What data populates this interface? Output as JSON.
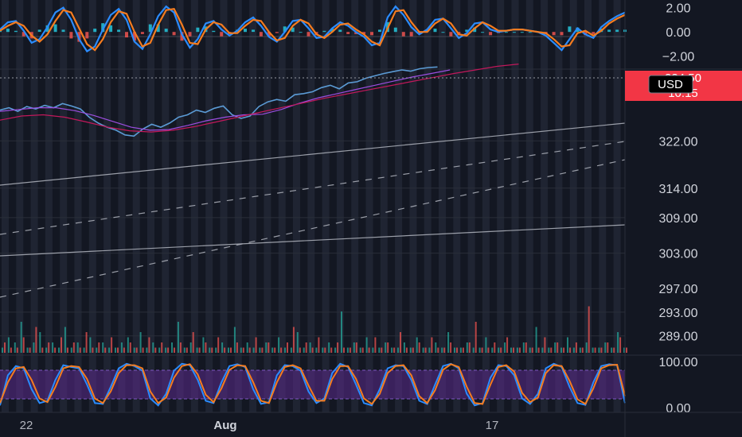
{
  "chart_data": [
    {
      "type": "line",
      "panel": "macd",
      "y_axis_ticks": [
        "2.00",
        "0.00",
        "−2.00"
      ],
      "ylim": [
        -3,
        2.5
      ],
      "series": [
        {
          "values": [
            0.2,
            0.8,
            0.9,
            0.1,
            -0.9,
            -0.6,
            0.4,
            1.6,
            2.0,
            1.0,
            -0.6,
            -1.6,
            -1.2,
            0.2,
            1.4,
            1.9,
            1.0,
            -0.8,
            -1.4,
            -0.2,
            1.3,
            2.1,
            1.6,
            -0.2,
            -1.3,
            -0.6,
            0.7,
            0.9,
            0.2,
            -0.3,
            0.1,
            0.8,
            1.2,
            0.5,
            -0.4,
            -0.8,
            0.0,
            0.9,
            1.0,
            0.3,
            -0.5,
            -0.4,
            0.3,
            0.8,
            0.5,
            0.0,
            -0.4,
            -1.1,
            -0.9,
            1.2,
            2.1,
            1.4,
            0.4,
            -0.2,
            0.2,
            1.0,
            1.1,
            0.3,
            -0.5,
            -0.1,
            0.7,
            0.8,
            0.2,
            0.0,
            0.1,
            0.2,
            0.2,
            0.1,
            0.0,
            -0.3,
            -0.9,
            -1.5,
            -0.6,
            0.3,
            -0.2,
            -0.5,
            0.4,
            0.9,
            1.3,
            1.6
          ],
          "color": "#2b8cff"
        },
        {
          "values": [
            0.1,
            0.5,
            0.8,
            0.5,
            -0.3,
            -0.8,
            -0.2,
            0.9,
            1.8,
            1.6,
            0.3,
            -1.0,
            -1.5,
            -0.6,
            0.8,
            1.7,
            1.5,
            0.0,
            -1.2,
            -0.9,
            0.6,
            1.8,
            1.9,
            0.6,
            -0.9,
            -1.0,
            0.2,
            0.8,
            0.6,
            -0.1,
            -0.1,
            0.5,
            1.0,
            0.9,
            0.0,
            -0.7,
            -0.5,
            0.5,
            1.0,
            0.7,
            -0.2,
            -0.5,
            0.0,
            0.6,
            0.7,
            0.2,
            -0.2,
            -0.8,
            -1.1,
            0.3,
            1.7,
            1.8,
            0.8,
            0.0,
            0.0,
            0.7,
            1.1,
            0.7,
            -0.2,
            -0.3,
            0.3,
            0.8,
            0.5,
            0.1,
            0.1,
            0.2,
            0.2,
            0.1,
            0.0,
            -0.1,
            -0.6,
            -1.2,
            -1.1,
            -0.1,
            0.1,
            -0.3,
            0.1,
            0.7,
            1.1,
            1.4
          ],
          "color": "#f57c1f"
        }
      ]
    },
    {
      "type": "line",
      "panel": "price",
      "y_axis_ticks": [
        "322.00",
        "314.00",
        "309.00",
        "303.00",
        "297.00",
        "293.00",
        "289.00"
      ],
      "partial_tick": "330.00",
      "ylim": [
        286,
        334
      ],
      "last_price_tag": {
        "price": "334.50",
        "countdown": "10:15"
      },
      "currency": "USD",
      "series": [
        {
          "values": [
            327.2,
            327.6,
            327.0,
            327.8,
            327.4,
            328.0,
            327.6,
            328.3,
            327.9,
            327.4,
            326.0,
            325.0,
            324.3,
            323.8,
            323.0,
            322.8,
            324.0,
            324.8,
            324.3,
            325.0,
            326.0,
            326.4,
            327.2,
            326.8,
            327.5,
            327.9,
            326.4,
            325.8,
            326.2,
            327.8,
            328.6,
            329.0,
            328.7,
            329.8,
            330.0,
            330.3,
            331.0,
            331.4,
            330.8,
            331.8,
            332.0,
            332.6,
            333.0,
            333.4,
            333.7,
            334.0,
            333.8,
            334.2,
            334.4,
            334.5
          ],
          "color": "#5b9bd5",
          "x_end_fraction": 0.7
        },
        {
          "values": [
            327.0,
            327.3,
            327.6,
            327.6,
            327.1,
            326.3,
            325.3,
            324.3,
            323.8,
            323.9,
            324.6,
            325.4,
            326.0,
            326.4,
            326.5,
            327.3,
            328.4,
            329.3,
            330.0,
            330.7,
            331.4,
            332.1,
            332.8,
            333.4,
            334.0
          ],
          "color": "#9c4ee0",
          "x_end_fraction": 0.72
        },
        {
          "values": [
            325.5,
            326.2,
            326.4,
            326.0,
            325.2,
            324.3,
            323.7,
            323.5,
            323.8,
            324.4,
            325.2,
            326.0,
            326.8,
            327.6,
            328.4,
            329.2,
            329.9,
            330.6,
            331.3,
            332.0,
            332.7,
            333.4,
            334.0,
            334.6,
            335.0
          ],
          "color": "#c2185b",
          "x_end_fraction": 0.83
        }
      ]
    },
    {
      "type": "line",
      "panel": "stochastic",
      "y_axis_ticks": [
        "100.00",
        "0.00"
      ],
      "ylim": [
        -5,
        105
      ],
      "band": [
        20,
        80
      ],
      "series": [
        {
          "values": [
            5,
            70,
            90,
            85,
            40,
            10,
            15,
            60,
            92,
            88,
            85,
            50,
            10,
            8,
            45,
            85,
            95,
            90,
            80,
            20,
            5,
            30,
            80,
            95,
            92,
            60,
            15,
            10,
            55,
            90,
            94,
            88,
            40,
            8,
            12,
            70,
            92,
            90,
            80,
            35,
            10,
            20,
            75,
            95,
            88,
            50,
            10,
            5,
            40,
            85,
            92,
            90,
            60,
            15,
            8,
            50,
            90,
            95,
            85,
            30,
            5,
            10,
            65,
            92,
            90,
            70,
            20,
            8,
            30,
            85,
            95,
            88,
            45,
            10,
            6,
            55,
            90,
            94,
            92,
            10
          ],
          "color": "#2b8cff"
        },
        {
          "values": [
            10,
            55,
            85,
            88,
            60,
            20,
            12,
            45,
            85,
            90,
            88,
            62,
            20,
            10,
            35,
            75,
            92,
            92,
            85,
            35,
            10,
            22,
            65,
            90,
            94,
            72,
            28,
            12,
            42,
            82,
            92,
            90,
            55,
            15,
            10,
            55,
            88,
            92,
            85,
            48,
            15,
            15,
            62,
            90,
            90,
            62,
            20,
            8,
            30,
            75,
            90,
            92,
            70,
            25,
            10,
            38,
            82,
            94,
            88,
            45,
            10,
            8,
            50,
            88,
            92,
            78,
            32,
            12,
            22,
            75,
            92,
            90,
            58,
            18,
            8,
            42,
            85,
            92,
            93,
            25
          ],
          "color": "#f57c1f"
        }
      ]
    },
    {
      "type": "bar",
      "panel": "volume",
      "series": [
        {
          "values": [
            1,
            3,
            2,
            6,
            1,
            2,
            4,
            1,
            2,
            1,
            5,
            1,
            2,
            1,
            3,
            1,
            2,
            1,
            1,
            2,
            3,
            1,
            4,
            1,
            2,
            1,
            1,
            2,
            6,
            1,
            2,
            1,
            3,
            1,
            1,
            2,
            1,
            5,
            1,
            2,
            1,
            1,
            2,
            1,
            3,
            1,
            1,
            4,
            1,
            2,
            1,
            1,
            2,
            1,
            8,
            1,
            2,
            1,
            3,
            1,
            1,
            2,
            1,
            1,
            2,
            1,
            3,
            1,
            1,
            2,
            1,
            4,
            1,
            1,
            2,
            1,
            1,
            3,
            1,
            1,
            2,
            1,
            1,
            2,
            1,
            5,
            1,
            1,
            2,
            1,
            3,
            1,
            1,
            2,
            1,
            1,
            2,
            1,
            4,
            1
          ],
          "color": "#26a69a"
        },
        {
          "values": [
            2,
            1,
            1,
            3,
            1,
            5,
            1,
            2,
            1,
            3,
            1,
            2,
            1,
            4,
            1,
            2,
            1,
            3,
            1,
            1,
            2,
            1,
            1,
            3,
            1,
            2,
            1,
            1,
            2,
            1,
            4,
            1,
            2,
            1,
            3,
            1,
            1,
            2,
            1,
            1,
            3,
            1,
            2,
            1,
            1,
            2,
            5,
            1,
            2,
            1,
            3,
            1,
            1,
            2,
            1,
            1,
            2,
            1,
            1,
            3,
            1,
            2,
            1,
            4,
            1,
            1,
            2,
            1,
            3,
            1,
            1,
            2,
            1,
            1,
            2,
            6,
            1,
            1,
            2,
            1,
            3,
            1,
            1,
            2,
            1,
            1,
            3,
            1,
            2,
            1,
            1,
            2,
            1,
            9,
            1,
            1,
            2,
            1,
            3,
            1
          ],
          "color": "#ef5350"
        }
      ]
    }
  ],
  "time_axis": {
    "labels": [
      "22",
      "Aug",
      "17"
    ]
  },
  "colors": {
    "background": "#131722",
    "session_band": "#242a38",
    "gridline": "#2a2e39",
    "price_tag": "#f23645",
    "usd_badge": "#000000",
    "stoch_band": "#5b2a8c",
    "trendline": "#b2b5be"
  }
}
